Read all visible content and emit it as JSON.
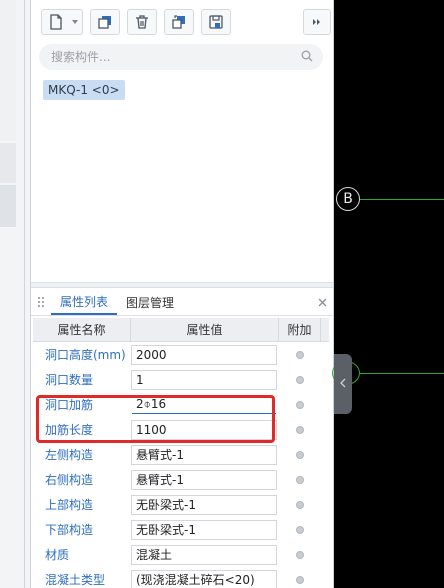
{
  "search": {
    "placeholder": "搜索构件..."
  },
  "component_tag": "MKQ-1 <0>",
  "tabs": [
    {
      "label": "属性列表",
      "active": true
    },
    {
      "label": "图层管理",
      "active": false
    }
  ],
  "grid": {
    "headers": [
      "属性名称",
      "属性值",
      "附加"
    ],
    "rows": [
      {
        "name": "洞口高度(mm)",
        "value": "2000"
      },
      {
        "name": "洞口数量",
        "value": "1"
      },
      {
        "name": "洞口加筋",
        "value": "2⌽16"
      },
      {
        "name": "加筋长度",
        "value": "1100"
      },
      {
        "name": "左侧构造",
        "value": "悬臂式-1"
      },
      {
        "name": "右侧构造",
        "value": "悬臂式-1"
      },
      {
        "name": "上部构造",
        "value": "无卧梁式-1"
      },
      {
        "name": "下部构造",
        "value": "无卧梁式-1"
      },
      {
        "name": "材质",
        "value": "混凝土"
      },
      {
        "name": "混凝土类型",
        "value": "(现浇混凝土碎石<20)"
      }
    ]
  },
  "canvas": {
    "axis_label": "B"
  },
  "colors": {
    "accent": "#2e6ec0",
    "highlight": "#e02a2a",
    "axis_line": "#2da82d"
  }
}
